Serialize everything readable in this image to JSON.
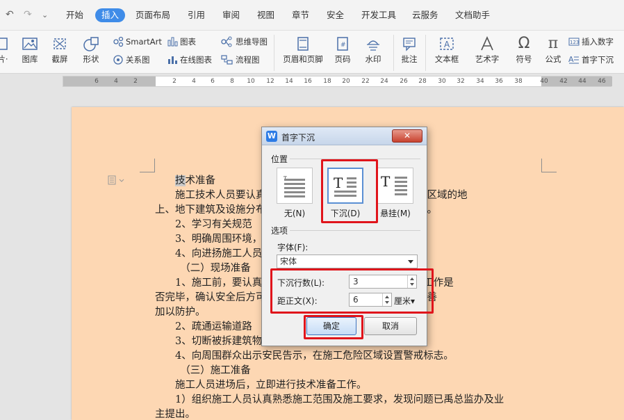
{
  "menu": {
    "tabs": [
      "开始",
      "插入",
      "页面布局",
      "引用",
      "审阅",
      "视图",
      "章节",
      "安全",
      "开发工具",
      "云服务",
      "文档助手"
    ],
    "active_tab": "插入"
  },
  "ribbon": {
    "picture": "片·",
    "gallery": "图库",
    "screenshot": "截屏",
    "shapes": "形状",
    "smartart": "SmartArt",
    "chart": "图表",
    "relation": "关系图",
    "online_chart": "在线图表",
    "mindmap": "思维导图",
    "flowchart": "流程图",
    "header_footer": "页眉和页脚",
    "page_number": "页码",
    "watermark": "水印",
    "comment": "批注",
    "textbox": "文本框",
    "wordart": "艺术字",
    "symbol": "符号",
    "formula": "公式",
    "insert_number": "插入数字",
    "dropcap": "首字下沉"
  },
  "ruler": {
    "ticks": [
      "6",
      "4",
      "2",
      "2",
      "4",
      "6",
      "8",
      "10",
      "12",
      "14",
      "16",
      "18",
      "20",
      "22",
      "24",
      "26",
      "28",
      "30",
      "32",
      "34",
      "36",
      "38",
      "40",
      "42",
      "44",
      "46"
    ]
  },
  "document": {
    "lines": [
      "技术准备",
      "施工技术人员要认真熟悉施工图纸及有关资料：工程涉及区域的地",
      "上、地下建筑及设施分布情况，依据有关资料，进行实地勘察。",
      "2、学习有关规范",
      "3、明确周围环境，周边地下管线、周边建筑物情况等。",
      "4、向进扬施工人员技术交底",
      "（二）现场准备",
      "1、施工前，要认真检查被拆除建筑物管线的切断、迁移工作是",
      "否完毕，确认安全后方可施工。对周围的设备，不能搬迁的妥善",
      "加以防护。",
      "2、疏通运输道路",
      "3、切断被拆建筑物",
      "4、向周围群众出示安民告示，在施工危险区域设置警戒标志。",
      "（三）施工准备",
      "施工人员进场后，立即进行技术准备工作。",
      "1）组织施工人员认真熟悉施工范围及施工要求，发现问题已禹总监办及业",
      "主提出。"
    ],
    "first_char": "技"
  },
  "dialog": {
    "title": "首字下沉",
    "close_label": "✕",
    "position_group": "位置",
    "options": [
      {
        "label": "无(N)",
        "glyph": "T"
      },
      {
        "label": "下沉(D)",
        "glyph": "T"
      },
      {
        "label": "悬挂(M)",
        "glyph": "T"
      }
    ],
    "selected_option": "下沉(D)",
    "options_group": "选项",
    "font_label": "字体(F):",
    "font_value": "宋体",
    "lines_label": "下沉行数(L):",
    "lines_value": "3",
    "distance_label": "距正文(X):",
    "distance_value": "6",
    "distance_unit": "厘米▾",
    "ok_label": "确定",
    "cancel_label": "取消"
  },
  "colors": {
    "page_background": "#fdd7b3",
    "active_tab": "#3f8ce8",
    "highlight_red": "#e0141b"
  }
}
